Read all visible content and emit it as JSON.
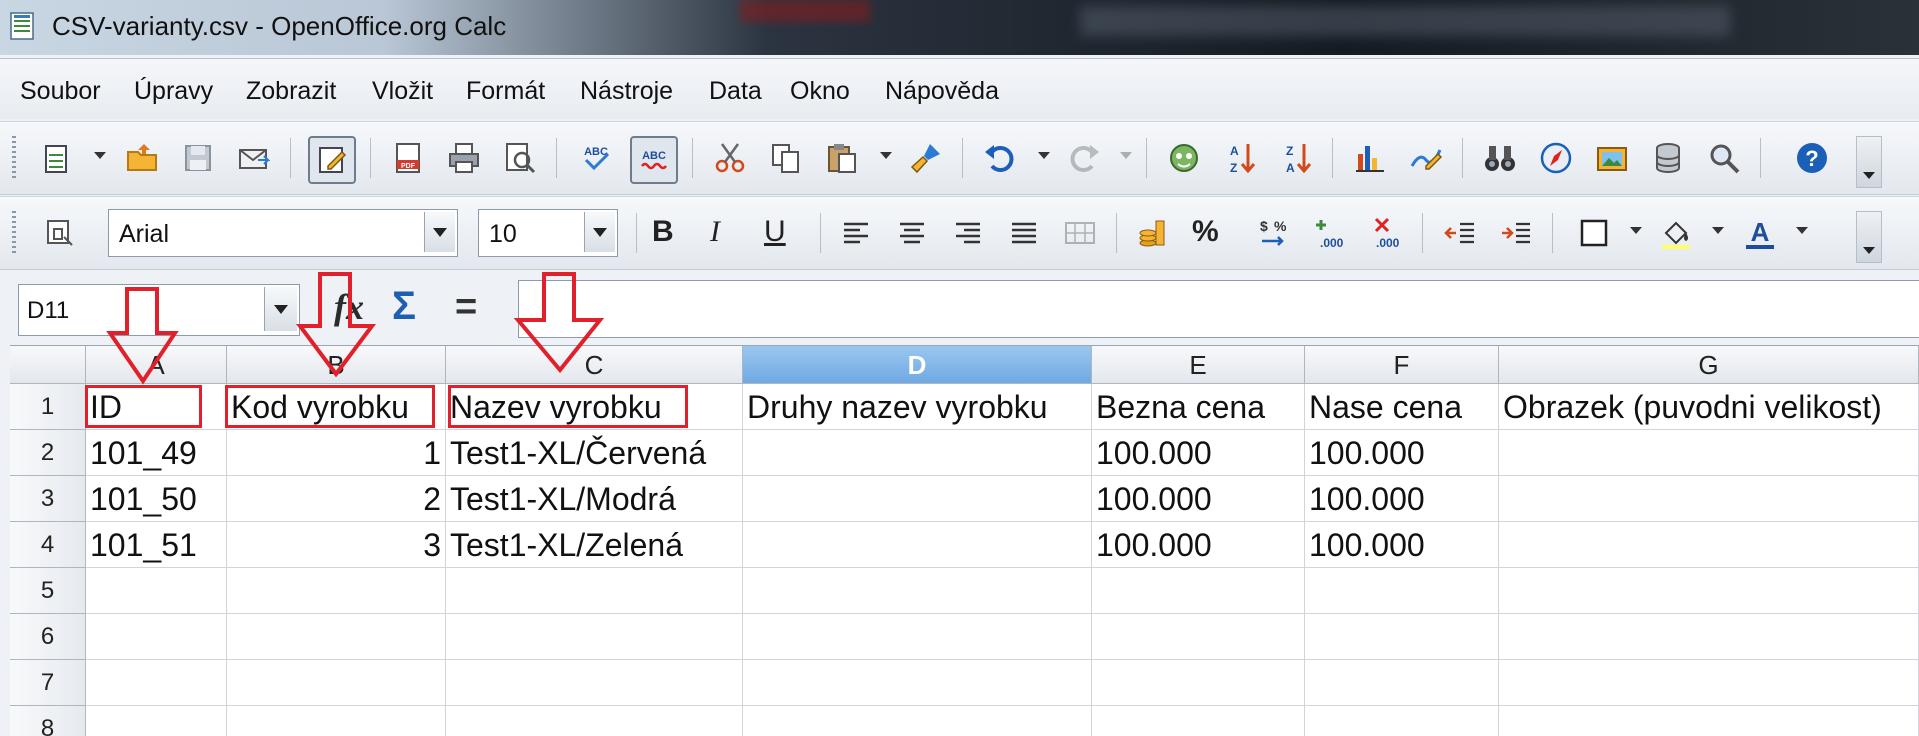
{
  "window": {
    "title": "CSV-varianty.csv - OpenOffice.org Calc"
  },
  "menu": [
    "Soubor",
    "Úpravy",
    "Zobrazit",
    "Vložit",
    "Formát",
    "Nástroje",
    "Data",
    "Okno",
    "Nápověda"
  ],
  "format_toolbar": {
    "font_name": "Arial",
    "font_size": "10"
  },
  "formula_bar": {
    "cell_ref": "D11",
    "formula": ""
  },
  "sheet": {
    "selected_column": "D",
    "columns": [
      "A",
      "B",
      "C",
      "D",
      "E",
      "F",
      "G"
    ],
    "rows": [
      "1",
      "2",
      "3",
      "4",
      "5",
      "6",
      "7",
      "8"
    ],
    "cells": [
      [
        "ID",
        "Kod vyrobku",
        "Nazev vyrobku",
        "Druhy nazev vyrobku",
        "Bezna cena",
        "Nase cena",
        "Obrazek (puvodni velikost)"
      ],
      [
        "101_49",
        "1",
        "Test1-XL/Červená",
        "",
        "100.000",
        "100.000",
        ""
      ],
      [
        "101_50",
        "2",
        "Test1-XL/Modrá",
        "",
        "100.000",
        "100.000",
        ""
      ],
      [
        "101_51",
        "3",
        "Test1-XL/Zelená",
        "",
        "100.000",
        "100.000",
        ""
      ],
      [
        "",
        "",
        "",
        "",
        "",
        "",
        ""
      ],
      [
        "",
        "",
        "",
        "",
        "",
        "",
        ""
      ],
      [
        "",
        "",
        "",
        "",
        "",
        "",
        ""
      ],
      [
        "",
        "",
        "",
        "",
        "",
        "",
        ""
      ]
    ]
  },
  "colors": {
    "annotation": "#e0202a",
    "selected_header": "#6fa9e3"
  }
}
